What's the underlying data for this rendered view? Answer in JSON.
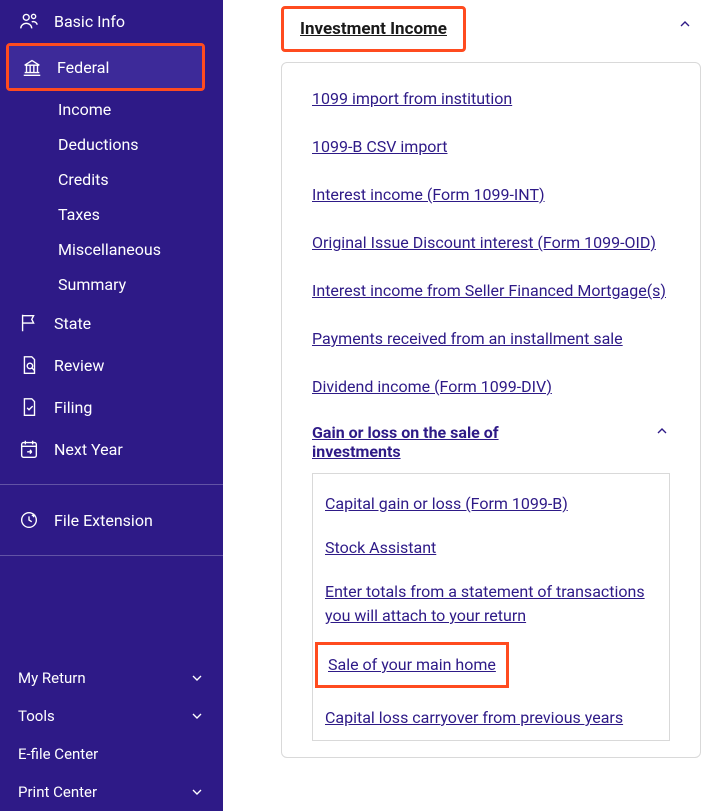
{
  "sidebar": {
    "items": [
      {
        "label": "Basic Info",
        "icon": "people-icon"
      },
      {
        "label": "Federal",
        "icon": "government-icon"
      }
    ],
    "federal_sub": [
      {
        "label": "Income"
      },
      {
        "label": "Deductions"
      },
      {
        "label": "Credits"
      },
      {
        "label": "Taxes"
      },
      {
        "label": "Miscellaneous"
      },
      {
        "label": "Summary"
      }
    ],
    "items2": [
      {
        "label": "State",
        "icon": "flag-icon"
      },
      {
        "label": "Review",
        "icon": "doc-search-icon"
      },
      {
        "label": "Filing",
        "icon": "doc-check-icon"
      },
      {
        "label": "Next Year",
        "icon": "calendar-arrow-icon"
      }
    ],
    "items3": [
      {
        "label": "File Extension",
        "icon": "clock-plus-icon"
      }
    ],
    "bottom": [
      {
        "label": "My Return",
        "expandable": true
      },
      {
        "label": "Tools",
        "expandable": true
      },
      {
        "label": "E-file Center",
        "expandable": false
      },
      {
        "label": "Print Center",
        "expandable": true
      }
    ]
  },
  "content": {
    "section_title": "Investment Income",
    "links": [
      "1099 import from institution",
      "1099-B CSV import",
      "Interest income (Form 1099-INT)",
      "Original Issue Discount interest (Form 1099-OID)",
      "Interest income from Seller Financed Mortgage(s)",
      "Payments received from an installment sale",
      "Dividend income (Form 1099-DIV)"
    ],
    "subsection_title": "Gain or loss on the sale of investments",
    "sub_links": [
      "Capital gain or loss (Form 1099-B)",
      "Stock Assistant",
      "Enter totals from a statement of transactions you will attach to your return",
      "Sale of your main home",
      "Capital loss carryover from previous years"
    ]
  }
}
